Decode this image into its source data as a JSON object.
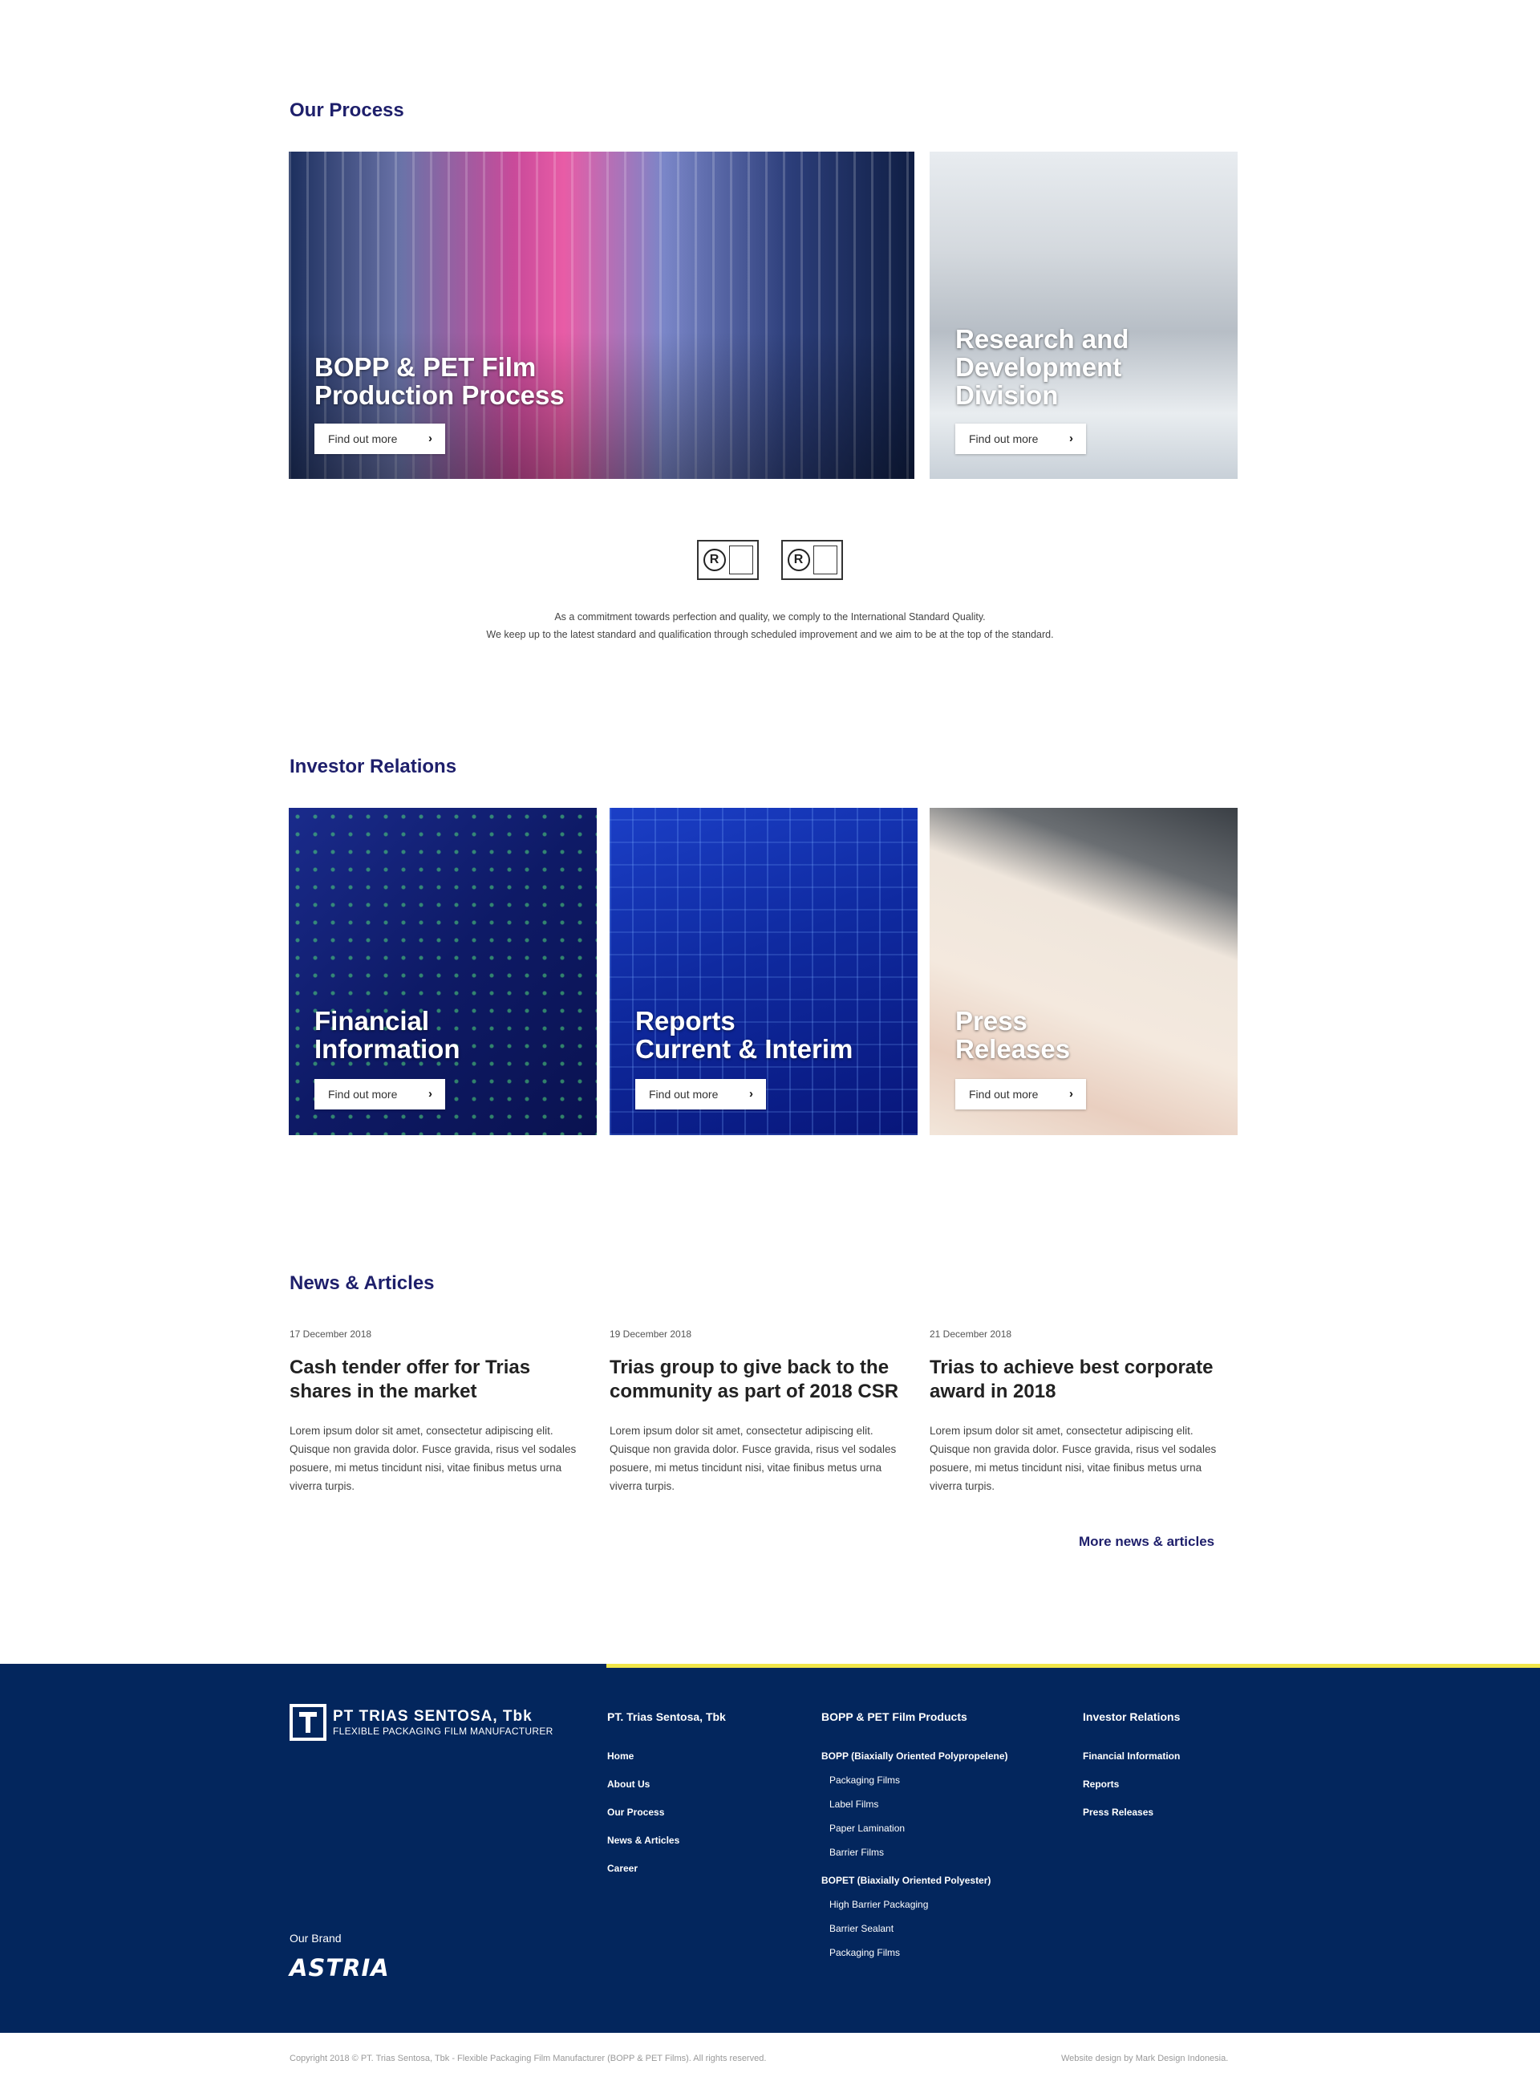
{
  "process": {
    "title": "Our Process",
    "cards": [
      {
        "title_line1": "BOPP & PET Film",
        "title_line2": "Production Process",
        "button": "Find out more"
      },
      {
        "title_line1": "Research and",
        "title_line2": "Development",
        "title_line3": "Division",
        "button": "Find out more"
      }
    ],
    "quality_line1": "As a commitment towards perfection and quality, we comply to the International Standard Quality.",
    "quality_line2": "We keep up to the latest standard and qualification through scheduled improvement and we aim to be at the top of the standard."
  },
  "investor": {
    "title": "Investor Relations",
    "cards": [
      {
        "title_line1": "Financial",
        "title_line2": "Information",
        "button": "Find out more"
      },
      {
        "title_line1": "Reports",
        "title_line2": "Current & Interim",
        "button": "Find out more"
      },
      {
        "title_line1": "Press",
        "title_line2": "Releases",
        "button": "Find out more"
      }
    ]
  },
  "news": {
    "title": "News & Articles",
    "items": [
      {
        "date": "17 December 2018",
        "title": "Cash tender offer for Trias shares in the market",
        "body": "Lorem ipsum dolor sit amet, consectetur adipiscing elit. Quisque non gravida dolor. Fusce gravida, risus vel sodales posuere, mi metus tincidunt nisi, vitae finibus metus urna viverra turpis."
      },
      {
        "date": "19 December 2018",
        "title": "Trias group to give back to the community as part of 2018 CSR",
        "body": "Lorem ipsum dolor sit amet, consectetur adipiscing elit. Quisque non gravida dolor. Fusce gravida, risus vel sodales posuere, mi metus tincidunt nisi, vitae finibus metus urna viverra turpis."
      },
      {
        "date": "21 December 2018",
        "title": "Trias to achieve best corporate award in 2018",
        "body": "Lorem ipsum dolor sit amet, consectetur adipiscing elit. Quisque non gravida dolor. Fusce gravida, risus vel sodales posuere, mi metus tincidunt nisi, vitae finibus metus urna viverra turpis."
      }
    ],
    "more": "More news & articles"
  },
  "footer": {
    "logo_name": "PT TRIAS SENTOSA, Tbk",
    "logo_tagline": "FLEXIBLE PACKAGING FILM MANUFACTURER",
    "col1": {
      "heading": "PT. Trias Sentosa, Tbk",
      "items": [
        "Home",
        "About Us",
        "Our Process",
        "News & Articles",
        "Career"
      ]
    },
    "col2": {
      "heading": "BOPP & PET Film Products",
      "group1": "BOPP (Biaxially Oriented Polypropelene)",
      "group1_items": [
        "Packaging Films",
        "Label Films",
        "Paper Lamination",
        "Barrier Films"
      ],
      "group2": "BOPET (Biaxially Oriented Polyester)",
      "group2_items": [
        "High Barrier Packaging",
        "Barrier Sealant",
        "Packaging Films"
      ]
    },
    "col3": {
      "heading": "Investor Relations",
      "items": [
        "Financial Information",
        "Reports",
        "Press Releases"
      ]
    },
    "brand_label": "Our Brand",
    "brand_name": "ASTRIA",
    "copyright": "Copyright 2018 © PT. Trias Sentosa, Tbk - Flexible Packaging Film Manufacturer (BOPP & PET Films). All rights reserved.",
    "credit": "Website design by Mark Design Indonesia."
  },
  "colors": {
    "navy": "#03265d",
    "title_blue": "#1e1f6b",
    "accent_yellow": "#f1e64a"
  }
}
